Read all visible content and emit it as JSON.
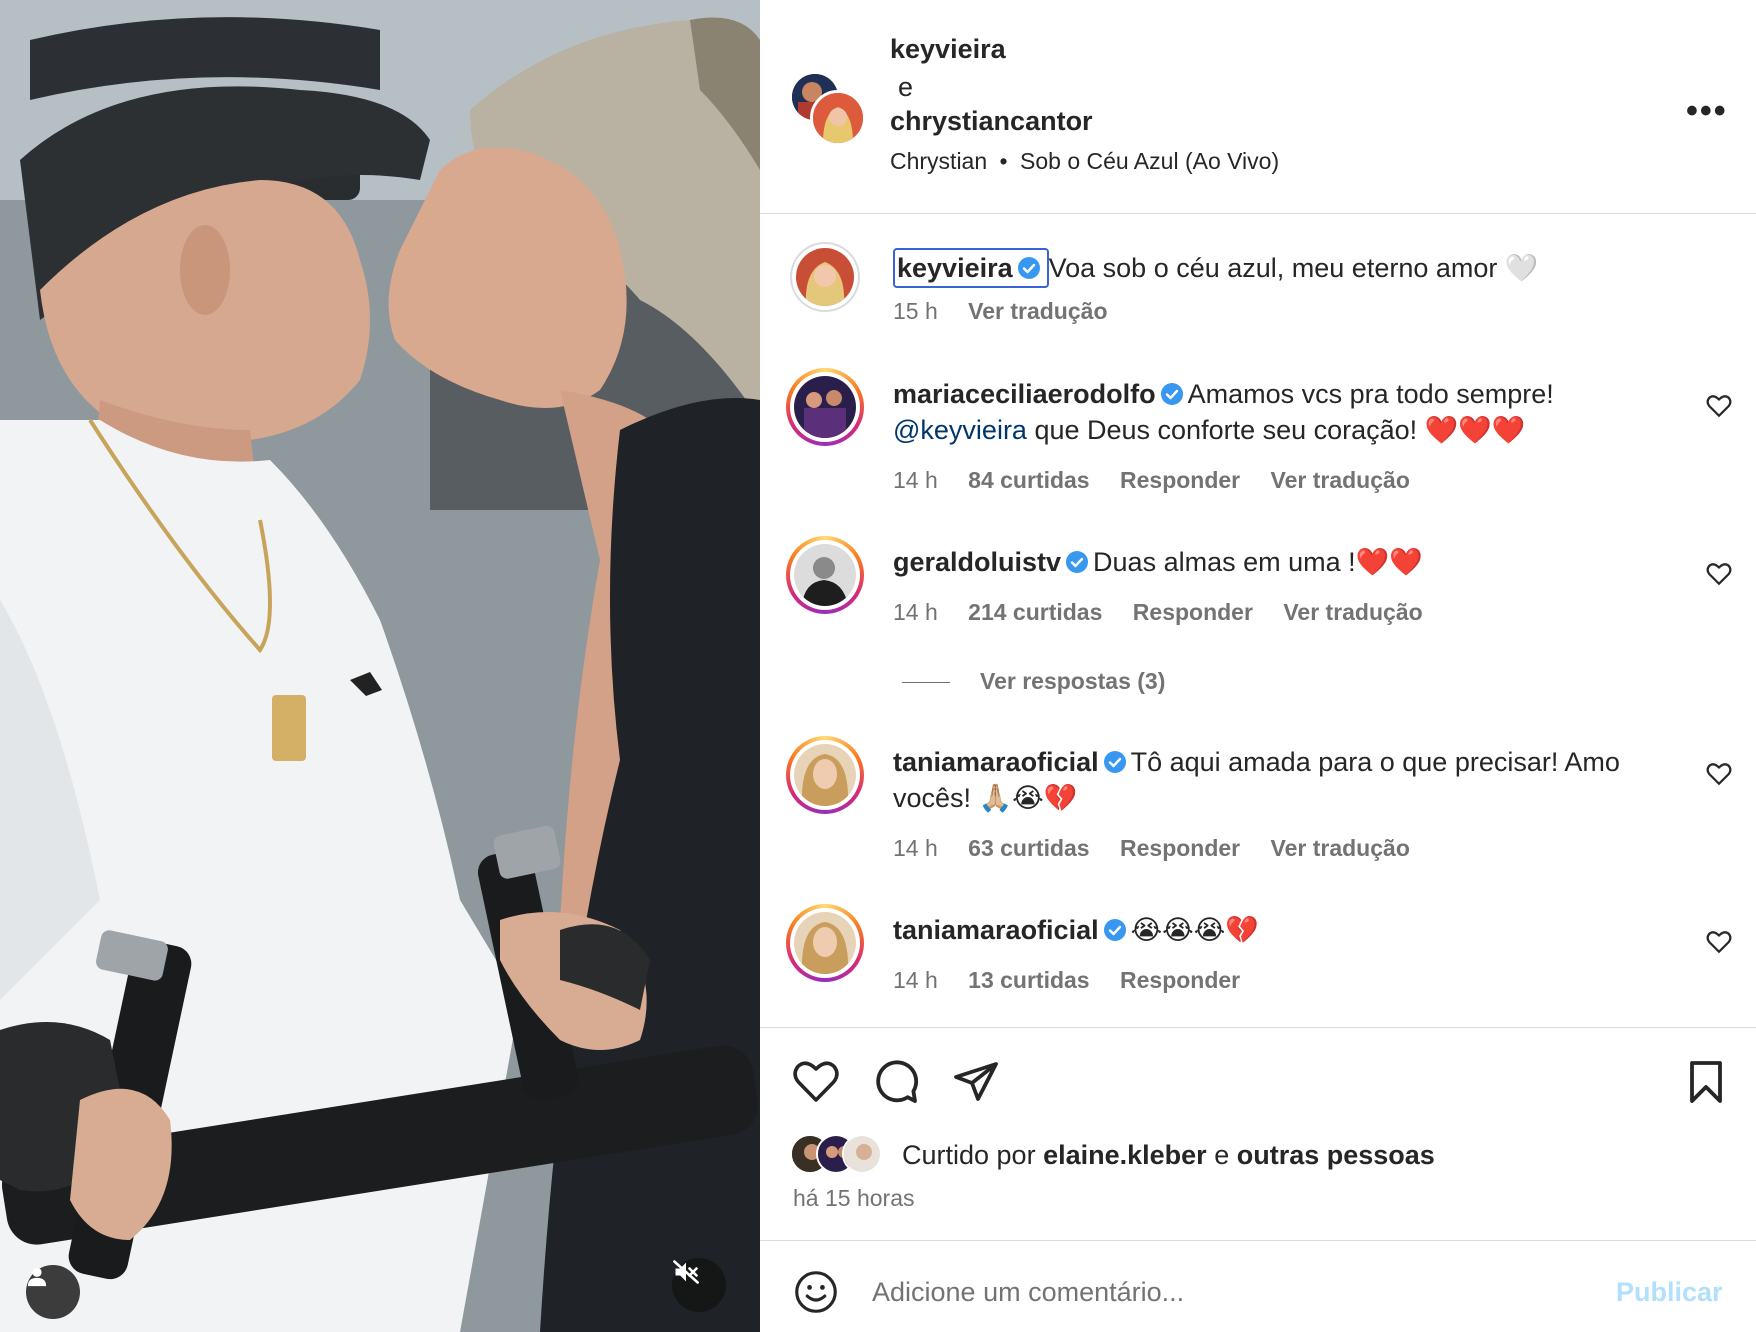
{
  "post": {
    "author_a": "keyvieira",
    "connector": "e",
    "author_b": "chrystiancantor",
    "audio_artist": "Chrystian",
    "audio_separator": "•",
    "audio_track": "Sob o Céu Azul (Ao Vivo)",
    "more_label": "•••"
  },
  "caption": {
    "username": "keyvieira",
    "text": "Voa sob o céu azul, meu eterno amor 🤍",
    "time": "15 h",
    "translate": "Ver tradução"
  },
  "comments": [
    {
      "username": "mariaceciliaerodolfo",
      "text_line1": "Amamos vcs pra todo sempre!",
      "mention": "@keyvieira",
      "text_rest": " que Deus conforte seu coração! ❤️❤️❤️",
      "time": "14 h",
      "likes": "84 curtidas",
      "reply": "Responder",
      "translate": "Ver tradução"
    },
    {
      "username": "geraldoluistv",
      "text": "Duas almas em uma !❤️❤️",
      "time": "14 h",
      "likes": "214 curtidas",
      "reply": "Responder",
      "translate": "Ver tradução",
      "view_replies": "Ver respostas (3)"
    },
    {
      "username": "taniamaraoficial",
      "text": "Tô aqui amada para o que precisar! Amo vocês! 🙏🏼😭💔",
      "time": "14 h",
      "likes": "63 curtidas",
      "reply": "Responder",
      "translate": "Ver tradução"
    },
    {
      "username": "taniamaraoficial",
      "text": "😭😭😭💔",
      "time": "14 h",
      "likes": "13 curtidas",
      "reply": "Responder"
    }
  ],
  "likes_summary": {
    "prefix": "Curtido por ",
    "user": "elaine.kleber",
    "joiner": " e ",
    "others": "outras pessoas"
  },
  "posted_ago": "há 15 horas",
  "composer": {
    "placeholder": "Adicione um comentário...",
    "publish": "Publicar"
  },
  "colors": {
    "verified": "#3897f0",
    "link": "#00376b",
    "publish_disabled": "#b2dffc",
    "secondary_text": "#737373"
  },
  "icons": [
    "person-tag-icon",
    "muted-speaker-icon",
    "more-options-icon",
    "verified-badge-icon",
    "heart-icon",
    "comment-icon",
    "share-icon",
    "bookmark-icon",
    "emoji-icon"
  ]
}
